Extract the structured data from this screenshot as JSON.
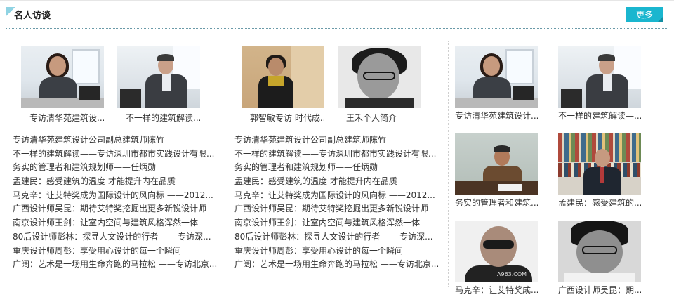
{
  "header": {
    "title": "名人访谈",
    "more_label": "更多"
  },
  "columns": [
    {
      "thumbs": [
        {
          "caption": "专访清华苑建筑设...",
          "photo": "office-woman"
        },
        {
          "caption": "不一样的建筑解读...",
          "photo": "office-man"
        }
      ],
      "list": [
        "专访清华苑建筑设计公司副总建筑师陈竹",
        "不一样的建筑解读——专访深圳市都市实践设计有限...",
        "务实的管理者和建筑规划师——任炳勋",
        "孟建民：感受建筑的温度 才能提升内在品质",
        "马克辛：让艾特奖成为国际设计的风向标 ——2012...",
        "广西设计师吴昆：期待艾特奖挖掘出更多新锐设计师",
        "南京设计师王剑：让室内空间与建筑风格浑然一体",
        "80后设计师彭林：探寻人文设计的行者 ——专访深...",
        "重庆设计师周彭：享受用心设计的每一个瞬间",
        "广阔：艺术是一场用生命奔跑的马拉松 ——专访北京..."
      ]
    },
    {
      "thumbs": [
        {
          "caption": "郭智敏专访 时代成...",
          "photo": "woman-wood"
        },
        {
          "caption": "王禾个人简介",
          "photo": "bw-glasses"
        }
      ],
      "list": [
        "专访清华苑建筑设计公司副总建筑师陈竹",
        "不一样的建筑解读——专访深圳市都市实践设计有限...",
        "务实的管理者和建筑规划师——任炳勋",
        "孟建民：感受建筑的温度 才能提升内在品质",
        "马克辛：让艾特奖成为国际设计的风向标 ——2012...",
        "广西设计师吴昆：期待艾特奖挖掘出更多新锐设计师",
        "南京设计师王剑：让室内空间与建筑风格浑然一体",
        "80后设计师彭林：探寻人文设计的行者 ——专访深...",
        "重庆设计师周彭：享受用心设计的每一个瞬间",
        "广阔：艺术是一场用生命奔跑的马拉松 ——专访北京..."
      ]
    },
    {
      "thumbs": [
        {
          "caption": "专访清华苑建筑设计...",
          "photo": "office-woman"
        },
        {
          "caption": "不一样的建筑解读—...",
          "photo": "office-man"
        },
        {
          "caption": "务实的管理者和建筑...",
          "photo": "man-desk"
        },
        {
          "caption": "孟建民：感受建筑的...",
          "photo": "man-bookshelf"
        },
        {
          "caption": "马克辛：让艾特奖成...",
          "photo": "bald-sunglasses"
        },
        {
          "caption": "广西设计师吴昆：期...",
          "photo": "bw-portrait"
        }
      ],
      "watermark": "A963.COM"
    }
  ],
  "colors": {
    "accent": "#1ab6cf",
    "text": "#333333"
  }
}
